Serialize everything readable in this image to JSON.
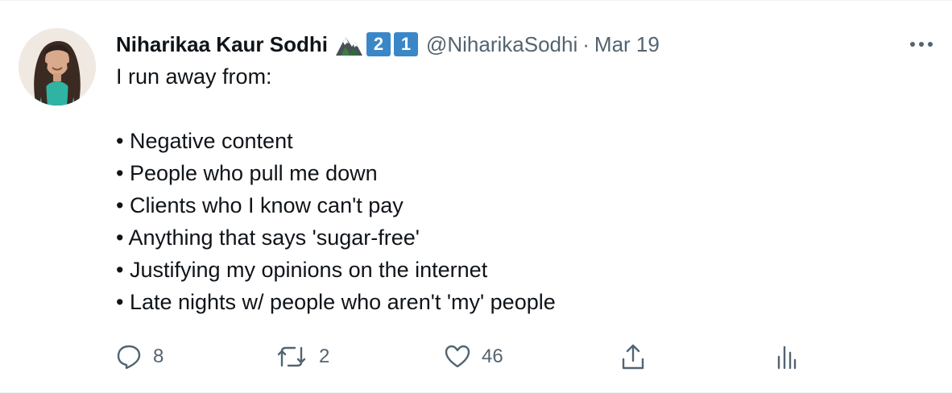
{
  "tweet": {
    "display_name": "Niharikaa Kaur Sodhi",
    "badges": [
      "2",
      "1"
    ],
    "handle": "@NiharikaSodhi",
    "separator": "·",
    "date": "Mar 19",
    "intro": "I run away from:",
    "bullets": [
      "• Negative content",
      "• People who pull me down",
      "• Clients who I know can't pay",
      "• Anything that says 'sugar-free'",
      "• Justifying my opinions on the internet",
      "• Late nights w/ people who aren't 'my' people"
    ],
    "replies": "8",
    "retweets": "2",
    "likes": "46"
  },
  "icons": {
    "badge_mountain": "mountain-emoji-icon",
    "more": "more-dots-icon",
    "reply": "reply-icon",
    "retweet": "retweet-icon",
    "like": "heart-icon",
    "share": "share-icon",
    "analytics": "analytics-icon"
  },
  "colors": {
    "text": "#0f1419",
    "secondary": "#536471",
    "badge_blue": "#3a87c8"
  }
}
